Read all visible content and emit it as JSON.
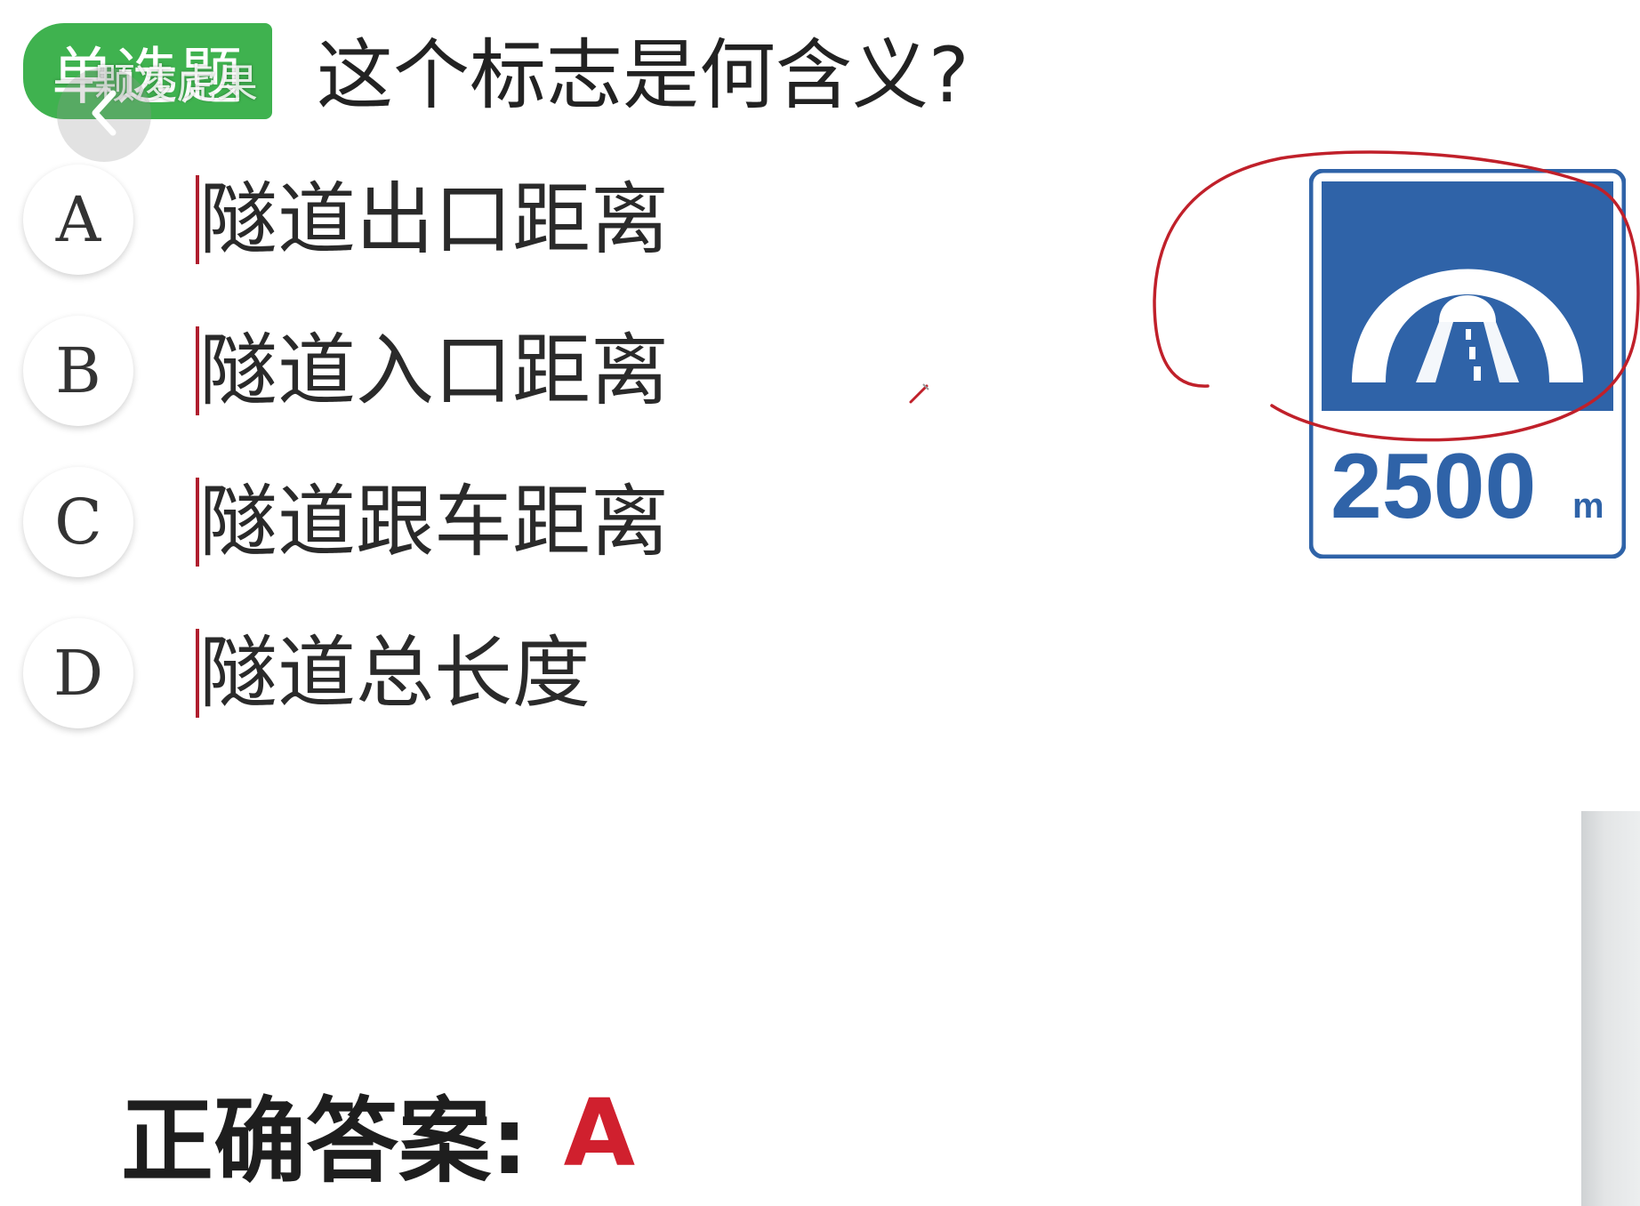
{
  "question": {
    "type_label": "单选题",
    "text": "这个标志是何含义?",
    "watermark": "一颗凌虎果"
  },
  "options": [
    {
      "letter": "A",
      "text": "隧道出口距离"
    },
    {
      "letter": "B",
      "text": "隧道入口距离"
    },
    {
      "letter": "C",
      "text": "隧道跟车距离"
    },
    {
      "letter": "D",
      "text": "隧道总长度"
    }
  ],
  "sign": {
    "distance": "2500",
    "unit": "m",
    "icon": "tunnel-icon",
    "colors": {
      "blue": "#2f63a8",
      "white": "#ffffff",
      "annotation": "#c0202a"
    }
  },
  "answer": {
    "label": "正确答案:",
    "value": "A"
  },
  "icons": {
    "back": "chevron-left-icon"
  },
  "colors": {
    "badge_green": "#3fb24f",
    "answer_red": "#d0202e"
  }
}
